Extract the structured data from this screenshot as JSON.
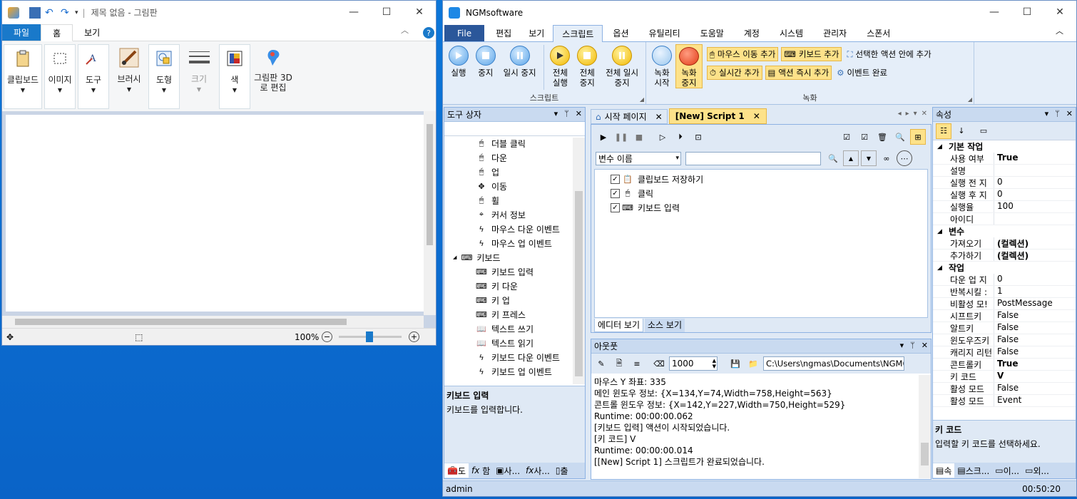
{
  "paint": {
    "title": "제목 없음 - 그림판",
    "tabs": [
      "파일",
      "홈",
      "보기"
    ],
    "ribbon": [
      {
        "name": "clipboard",
        "label": "클립보드"
      },
      {
        "name": "image",
        "label": "이미지"
      },
      {
        "name": "tools",
        "label": "도구"
      },
      {
        "name": "brushes",
        "label": "브러시"
      },
      {
        "name": "shapes",
        "label": "도형"
      },
      {
        "name": "size",
        "label": "크기"
      },
      {
        "name": "colors",
        "label": "색"
      },
      {
        "name": "paint3d",
        "label": "그림판 3D로 편집"
      }
    ],
    "zoom": "100%",
    "zoom_fraction": 0.5
  },
  "ngm": {
    "title": "NGMsoftware",
    "tabs": [
      "File",
      "편집",
      "보기",
      "스크립트",
      "옵션",
      "유틸리티",
      "도움말",
      "계정",
      "시스템",
      "관리자",
      "스폰서"
    ],
    "script_group": {
      "label": "스크립트",
      "buttons": [
        "실행",
        "중지",
        "일시 중지",
        "전체 실행",
        "전체 중지",
        "전체 일시 중지"
      ]
    },
    "record_group": {
      "label": "녹화",
      "buttons": [
        "녹화 시작",
        "녹화 중지"
      ],
      "small": [
        "마우스 이동 추가",
        "키보드 추가",
        "선택한 액션 안에 추가",
        "실시간 추가",
        "액션 즉시 추가",
        "이벤트 완료"
      ]
    },
    "toolbox": {
      "title": "도구 상자",
      "items": [
        {
          "label": "더블 클릭",
          "icon": "mouse-icon",
          "indent": 2
        },
        {
          "label": "다운",
          "icon": "mouse-icon",
          "indent": 2
        },
        {
          "label": "업",
          "icon": "mouse-icon",
          "indent": 2
        },
        {
          "label": "이동",
          "icon": "move-icon",
          "indent": 2
        },
        {
          "label": "휠",
          "icon": "mouse-icon",
          "indent": 2
        },
        {
          "label": "커서 정보",
          "icon": "cursor-icon",
          "indent": 2
        },
        {
          "label": "마우스 다운 이벤트",
          "icon": "lightning-icon",
          "indent": 2
        },
        {
          "label": "마우스 업 이벤트",
          "icon": "lightning-icon",
          "indent": 2
        },
        {
          "label": "키보드",
          "icon": "keyboard-icon",
          "indent": 1
        },
        {
          "label": "키보드 입력",
          "icon": "keyboard-icon",
          "indent": 2
        },
        {
          "label": "키 다운",
          "icon": "keyboard-icon",
          "indent": 2
        },
        {
          "label": "키 업",
          "icon": "keyboard-icon",
          "indent": 2
        },
        {
          "label": "키 프레스",
          "icon": "keyboard-icon",
          "indent": 2
        },
        {
          "label": "텍스트 쓰기",
          "icon": "book-icon",
          "indent": 2
        },
        {
          "label": "텍스트 읽기",
          "icon": "book-icon",
          "indent": 2
        },
        {
          "label": "키보드 다운 이벤트",
          "icon": "lightning-icon",
          "indent": 2
        },
        {
          "label": "키보드 업 이벤트",
          "icon": "lightning-icon",
          "indent": 2
        }
      ],
      "desc_title": "키보드 입력",
      "desc_text": "키보드를 입력합니다.",
      "bottom_tabs": [
        "도",
        "함",
        "사...",
        "사...",
        "출"
      ]
    },
    "doc_tabs": [
      "시작 페이지",
      "[New] Script 1"
    ],
    "var_select": "변수 이름",
    "script_items": [
      "클립보드 저장하기",
      "클릭",
      "키보드 입력"
    ],
    "editor_tabs": [
      "에디터 보기",
      "소스 보기"
    ],
    "output": {
      "title": "아웃풋",
      "count": "1000",
      "path": "C:\\Users\\ngmas\\Documents\\NGM6\\",
      "lines": [
        "마우스 Y 좌표: 335",
        "메인 윈도우 정보: {X=134,Y=74,Width=758,Height=563}",
        "콘트롤 윈도우 정보: {X=142,Y=227,Width=750,Height=529}",
        "Runtime: 00:00:00.062",
        "[키보드 입력] 액션이 시작되었습니다.",
        "[키 코드] V",
        "Runtime: 00:00:00.014",
        "[[New] Script 1] 스크립트가 완료되었습니다."
      ]
    },
    "props": {
      "title": "속성",
      "cats": [
        {
          "name": "기본 작업",
          "rows": [
            [
              "사용 여부",
              "True"
            ],
            [
              "설명",
              ""
            ],
            [
              "실행 전 지",
              "0"
            ],
            [
              "실행 후 지",
              "0"
            ],
            [
              "실행율",
              "100"
            ],
            [
              "아이디",
              ""
            ]
          ]
        },
        {
          "name": "변수",
          "rows": [
            [
              "가져오기",
              "(컬렉션)"
            ],
            [
              "추가하기",
              "(컬렉션)"
            ]
          ]
        },
        {
          "name": "작업",
          "rows": [
            [
              "다운 업 지",
              "0"
            ],
            [
              "반복시킬 :",
              "1"
            ],
            [
              "비활성 모!",
              "PostMessage"
            ],
            [
              "시프트키",
              "False"
            ],
            [
              "알트키",
              "False"
            ],
            [
              "윈도우즈키",
              "False"
            ],
            [
              "캐리지 리턴",
              "False"
            ],
            [
              "콘트롤키",
              "True"
            ],
            [
              "키 코드",
              "V"
            ],
            [
              "활성 모드",
              "False"
            ],
            [
              "활성 모드",
              "Event"
            ]
          ]
        }
      ],
      "desc_title": "키 코드",
      "desc_text": "입력할 키 코드를 선택하세요.",
      "bottom_tabs": [
        "속",
        "스크...",
        "이...",
        "외..."
      ]
    },
    "status": {
      "user": "admin",
      "time": "00:50:20"
    }
  }
}
